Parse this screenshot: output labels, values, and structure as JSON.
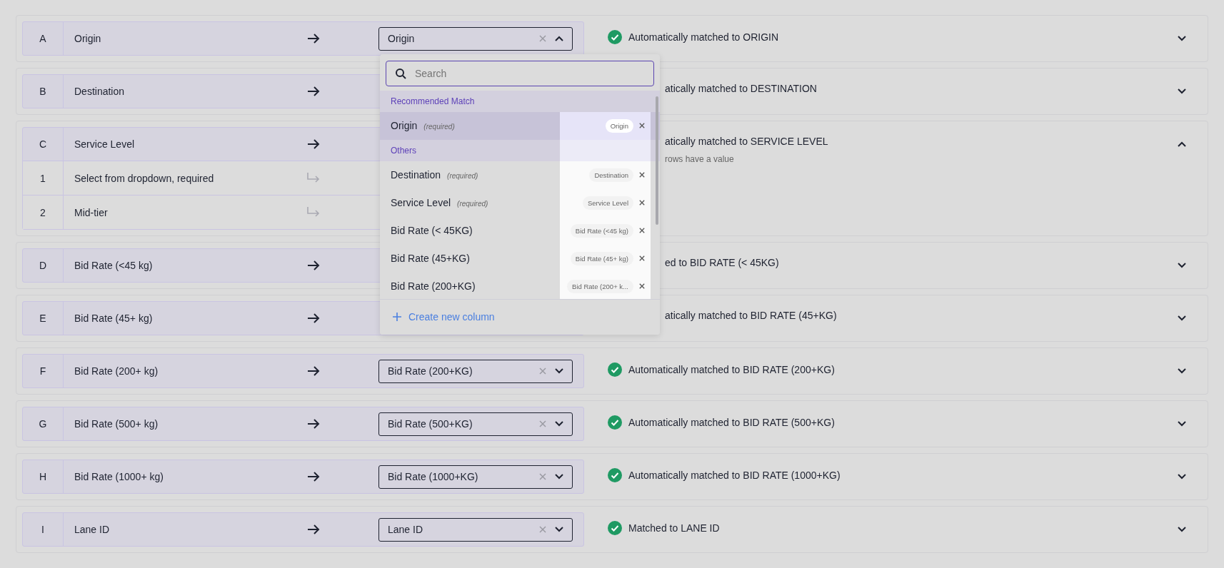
{
  "rows": [
    {
      "letter": "A",
      "name": "Origin",
      "mapped": "Origin",
      "dropdown_open": true,
      "covered": false,
      "status": "Automatically matched to ORIGIN",
      "expanded": false
    },
    {
      "letter": "B",
      "name": "Destination",
      "covered": true,
      "status": "atically matched to DESTINATION",
      "expanded": false
    },
    {
      "letter": "C",
      "name": "Service Level",
      "covered": true,
      "status": "atically matched to SERVICE LEVEL",
      "note": "rows have a value",
      "expanded": true,
      "subrows": [
        {
          "letter": "1",
          "name": "Select from dropdown, required"
        },
        {
          "letter": "2",
          "name": "Mid-tier"
        }
      ]
    },
    {
      "letter": "D",
      "name": "Bid Rate (<45 kg)",
      "covered": true,
      "status": "ed to BID RATE (< 45KG)",
      "expanded": false
    },
    {
      "letter": "E",
      "name": "Bid Rate (45+ kg)",
      "covered": true,
      "status": "atically matched to BID RATE (45+KG)",
      "expanded": false
    },
    {
      "letter": "F",
      "name": "Bid Rate (200+ kg)",
      "mapped": "Bid Rate (200+KG)",
      "dropdown_open": false,
      "covered": false,
      "status": "Automatically matched to BID RATE (200+KG)",
      "expanded": false
    },
    {
      "letter": "G",
      "name": "Bid Rate (500+ kg)",
      "mapped": "Bid Rate (500+KG)",
      "dropdown_open": false,
      "covered": false,
      "status": "Automatically matched to BID RATE (500+KG)",
      "expanded": false
    },
    {
      "letter": "H",
      "name": "Bid Rate (1000+ kg)",
      "mapped": "Bid Rate (1000+KG)",
      "dropdown_open": false,
      "covered": false,
      "status": "Automatically matched to BID RATE (1000+KG)",
      "expanded": false
    },
    {
      "letter": "I",
      "name": "Lane ID",
      "mapped": "Lane ID",
      "dropdown_open": false,
      "covered": false,
      "status": "Matched to LANE ID",
      "expanded": false
    }
  ],
  "dropdown": {
    "search": {
      "placeholder": "Search"
    },
    "groups": [
      {
        "heading": "Recommended Match",
        "options": [
          {
            "label": "Origin",
            "hint": "(required)",
            "chip": "Origin",
            "selected": true
          }
        ]
      },
      {
        "heading": "Others",
        "options": [
          {
            "label": "Destination",
            "hint": "(required)",
            "chip": "Destination",
            "selected": false
          },
          {
            "label": "Service Level",
            "hint": "(required)",
            "chip": "Service Level",
            "selected": false
          },
          {
            "label": "Bid Rate (< 45KG)",
            "chip": "Bid Rate (<45 kg)",
            "selected": false
          },
          {
            "label": "Bid Rate (45+KG)",
            "chip": "Bid Rate (45+ kg)",
            "selected": false
          },
          {
            "label": "Bid Rate (200+KG)",
            "chip": "Bid Rate (200+ k...",
            "selected": false
          }
        ]
      }
    ],
    "create": "Create new column"
  }
}
